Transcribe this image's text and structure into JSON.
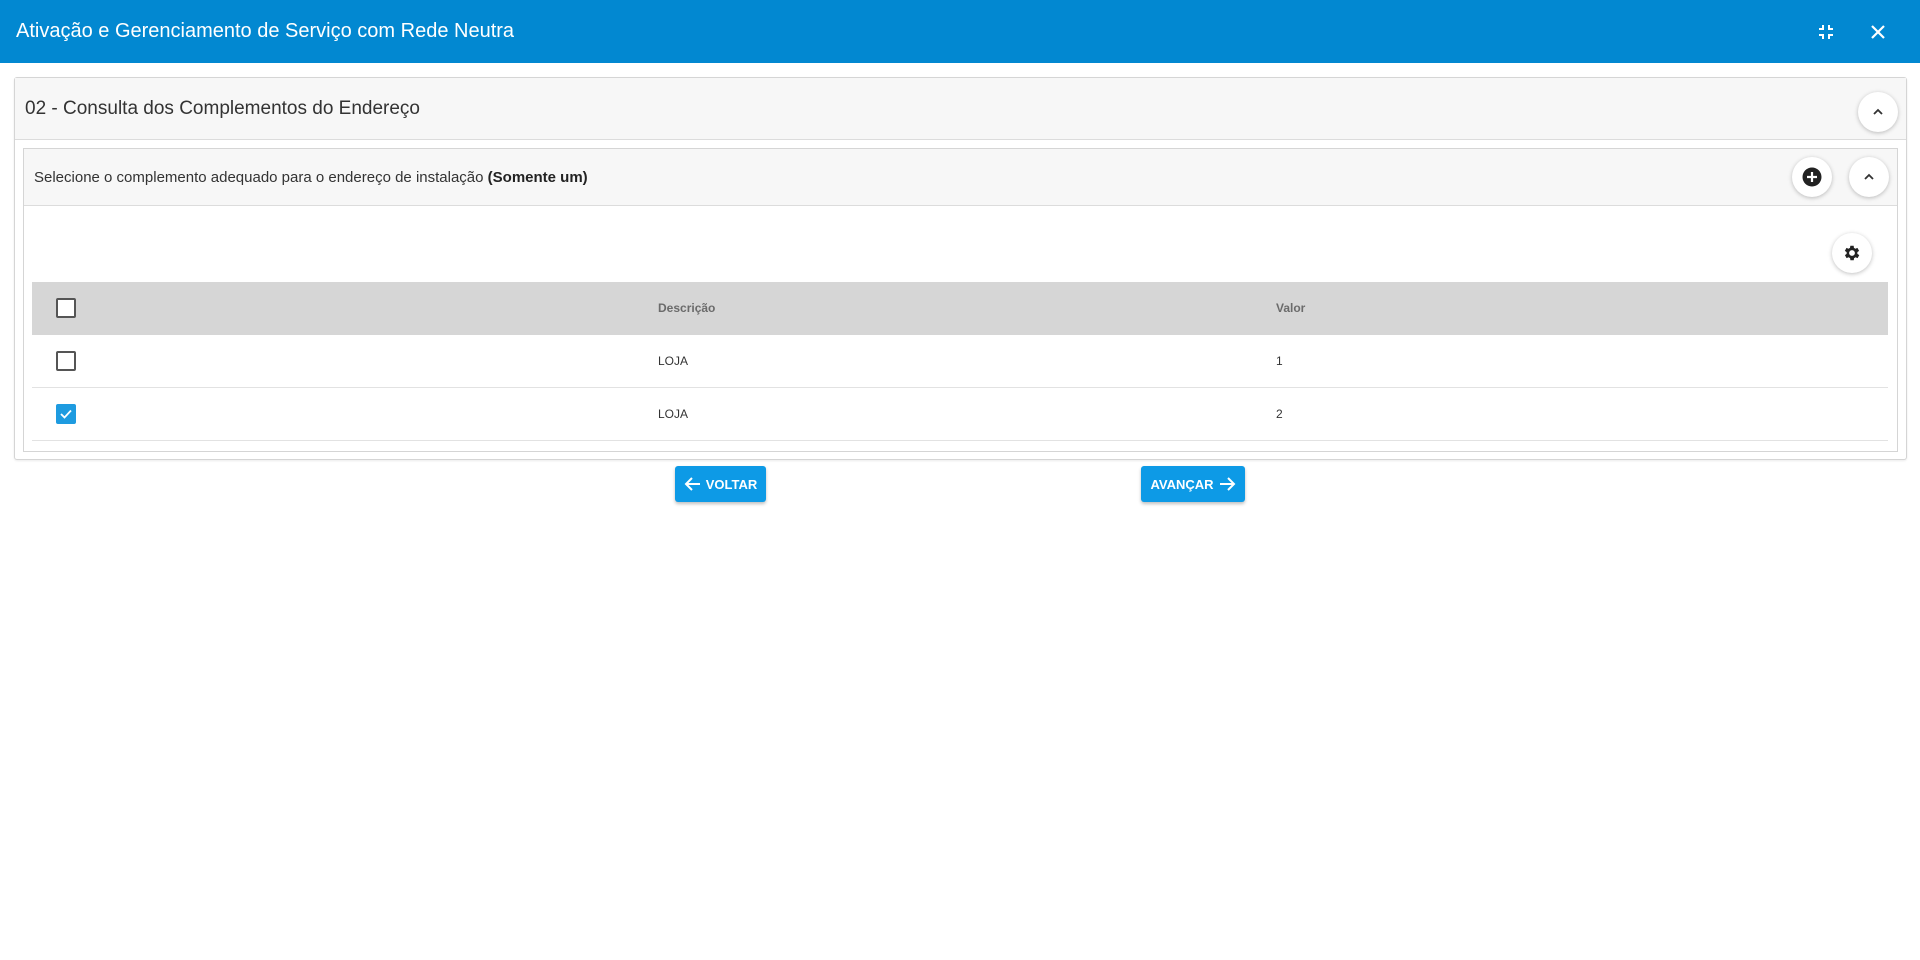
{
  "window": {
    "title": "Ativação e Gerenciamento de Serviço com Rede Neutra",
    "accent_color": "#0288d1"
  },
  "section": {
    "title": "02 - Consulta dos Complementos do Endereço"
  },
  "subsection": {
    "title_text": "Selecione o complemento adequado para o endereço de instalação ",
    "title_emphasis": "(Somente um)"
  },
  "table": {
    "columns": [
      "",
      "Descrição",
      "Valor"
    ],
    "rows": [
      {
        "checked": false,
        "descricao": "LOJA",
        "valor": "1"
      },
      {
        "checked": true,
        "descricao": "LOJA",
        "valor": "2"
      }
    ]
  },
  "buttons": {
    "back_label": "VOLTAR",
    "next_label": "AVANÇAR"
  },
  "icons": {
    "minimize": "fullscreen-exit-icon",
    "close": "close-icon",
    "collapse": "chevron-up-icon",
    "add": "plus-circle-icon",
    "settings": "gear-icon",
    "back": "arrow-left-icon",
    "next": "arrow-right-icon",
    "check": "check-icon"
  }
}
